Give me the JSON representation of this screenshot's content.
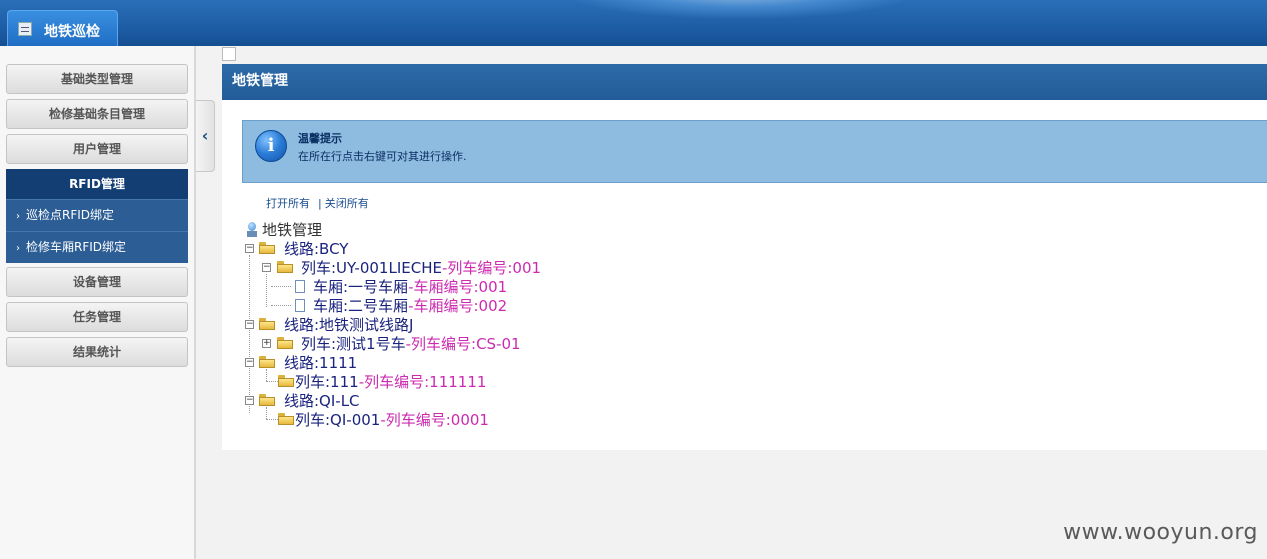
{
  "app": {
    "tab_label": "地铁巡检"
  },
  "sidebar": {
    "items": [
      {
        "label": "基础类型管理"
      },
      {
        "label": "检修基础条目管理"
      },
      {
        "label": "用户管理"
      }
    ],
    "group": {
      "label": "RFID管理",
      "sub_items": [
        {
          "label": "巡检点RFID绑定"
        },
        {
          "label": "检修车厢RFID绑定"
        }
      ]
    },
    "items_after": [
      {
        "label": "设备管理"
      },
      {
        "label": "任务管理"
      },
      {
        "label": "结果统计"
      }
    ]
  },
  "panel": {
    "title": "地铁管理",
    "notice": {
      "title": "温馨提示",
      "text": "在所在行点击右键可对其进行操作."
    },
    "links": {
      "open_all": "打开所有",
      "close_all": "关闭所有",
      "separator": "|"
    }
  },
  "tree": {
    "root": "地铁管理",
    "nodes": [
      {
        "label": "线路:BCY",
        "code": ""
      },
      {
        "label": "列车:UY-001LIECHE",
        "code": "-列车编号:001"
      },
      {
        "label": "车厢:一号车厢",
        "code": "-车厢编号:001"
      },
      {
        "label": "车厢:二号车厢",
        "code": "-车厢编号:002"
      },
      {
        "label": "线路:地铁测试线路J",
        "code": ""
      },
      {
        "label": "列车:测试1号车",
        "code": "-列车编号:CS-01"
      },
      {
        "label": "线路:1111",
        "code": ""
      },
      {
        "label": "列车:111",
        "code": "-列车编号:111111"
      },
      {
        "label": "线路:QI-LC",
        "code": ""
      },
      {
        "label": "列车:QI-001",
        "code": "-列车编号:0001"
      }
    ]
  },
  "watermark": "www.wooyun.org"
}
